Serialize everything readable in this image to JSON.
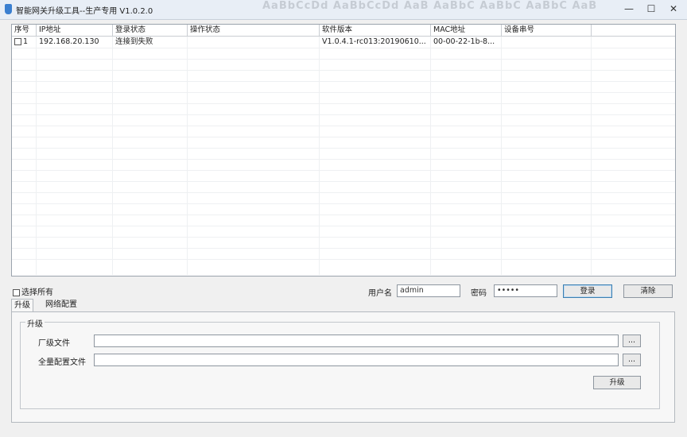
{
  "window": {
    "title": "智能网关升级工具--生产专用 V1.0.2.0",
    "deco_text": "AaBbCcDd  AaBbCcDd  AaB  AaBbC  AaBbC  AaBbC  AaBbCcDd  AaBbCcDd",
    "minimize_glyph": "—",
    "maximize_glyph": "☐",
    "close_glyph": "✕"
  },
  "table": {
    "columns": [
      "序号",
      "IP地址",
      "登录状态",
      "操作状态",
      "软件版本",
      "MAC地址",
      "设备串号"
    ],
    "rows": [
      {
        "checked": false,
        "index": "1",
        "ip": "192.168.20.130",
        "login_status": "连接到失败",
        "op_status": "",
        "version": "V1.0.4.1-rc013:20190610...",
        "mac": "00-00-22-1b-8...",
        "serial": ""
      }
    ]
  },
  "select_all_label": "选择所有",
  "login": {
    "username_label": "用户名",
    "username_value": "admin",
    "password_label": "密码",
    "password_value": "•••••",
    "login_button": "登录",
    "clear_button": "清除"
  },
  "tabs": [
    "升级",
    "网络配置"
  ],
  "upgrade": {
    "group_title": "升级",
    "firmware_label": "厂级文件",
    "firmware_value": "",
    "config_label": "全量配置文件",
    "config_value": "",
    "browse_label": "...",
    "upgrade_button": "升级"
  }
}
